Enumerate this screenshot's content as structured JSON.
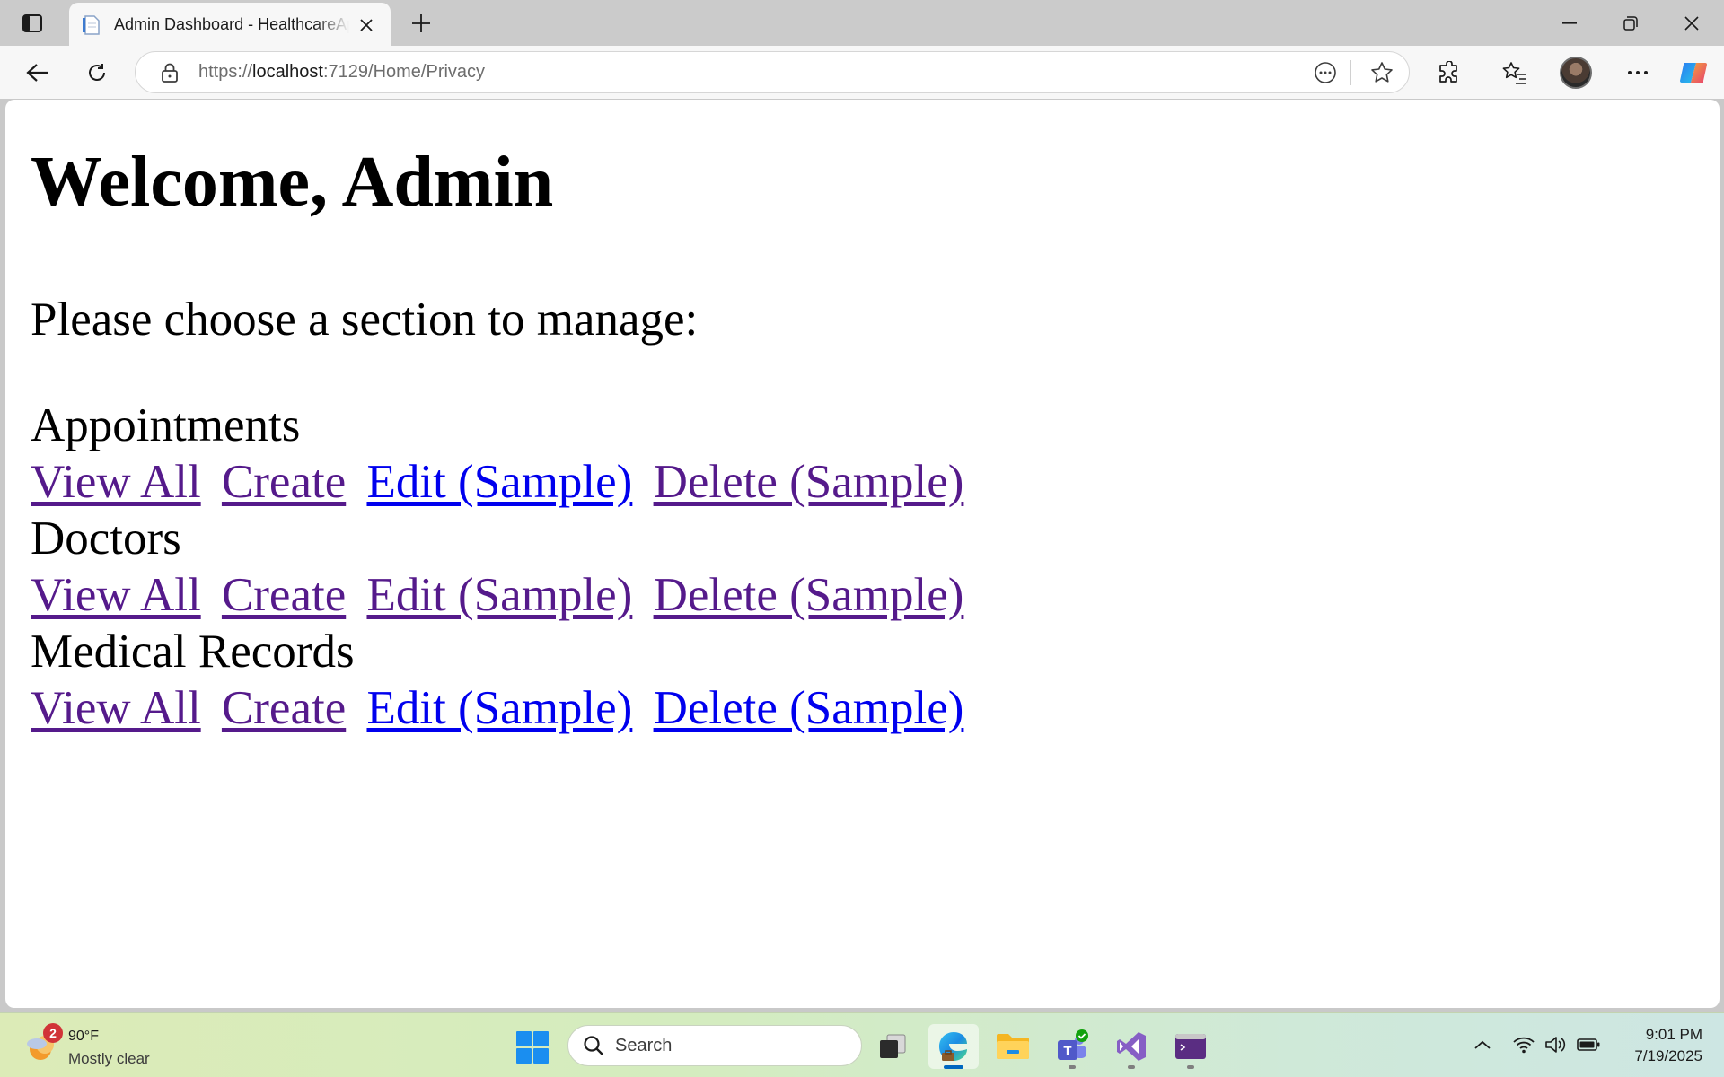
{
  "browser": {
    "tab_title": "Admin Dashboard - HealthcareApp",
    "url_scheme": "https://",
    "url_host": "localhost",
    "url_rest": ":7129/Home/Privacy"
  },
  "page": {
    "title": "Welcome, Admin",
    "intro": "Please choose a section to manage:",
    "sections": [
      {
        "heading": "Appointments",
        "links": [
          "View All",
          "Create",
          "Edit (Sample)",
          "Delete (Sample)"
        ]
      },
      {
        "heading": "Doctors",
        "links": [
          "View All",
          "Create",
          "Edit (Sample)",
          "Delete (Sample)"
        ]
      },
      {
        "heading": "Medical Records",
        "links": [
          "View All",
          "Create",
          "Edit (Sample)",
          "Delete (Sample)"
        ]
      }
    ],
    "link_colors": {
      "visited": "#551a8b",
      "unvisited": "#0000ee"
    }
  },
  "taskbar": {
    "weather_badge": "2",
    "weather_temp": "90°F",
    "weather_desc": "Mostly clear",
    "search_placeholder": "Search",
    "time": "9:01 PM",
    "date": "7/19/2025",
    "apps": [
      "task-view-icon",
      "edge-icon",
      "file-explorer-icon",
      "teams-icon",
      "visual-studio-icon",
      "terminal-icon"
    ]
  },
  "colors": {
    "accent": "#0067c0",
    "taskbar_start": "#dcebb7",
    "taskbar_end": "#cde6e3"
  }
}
